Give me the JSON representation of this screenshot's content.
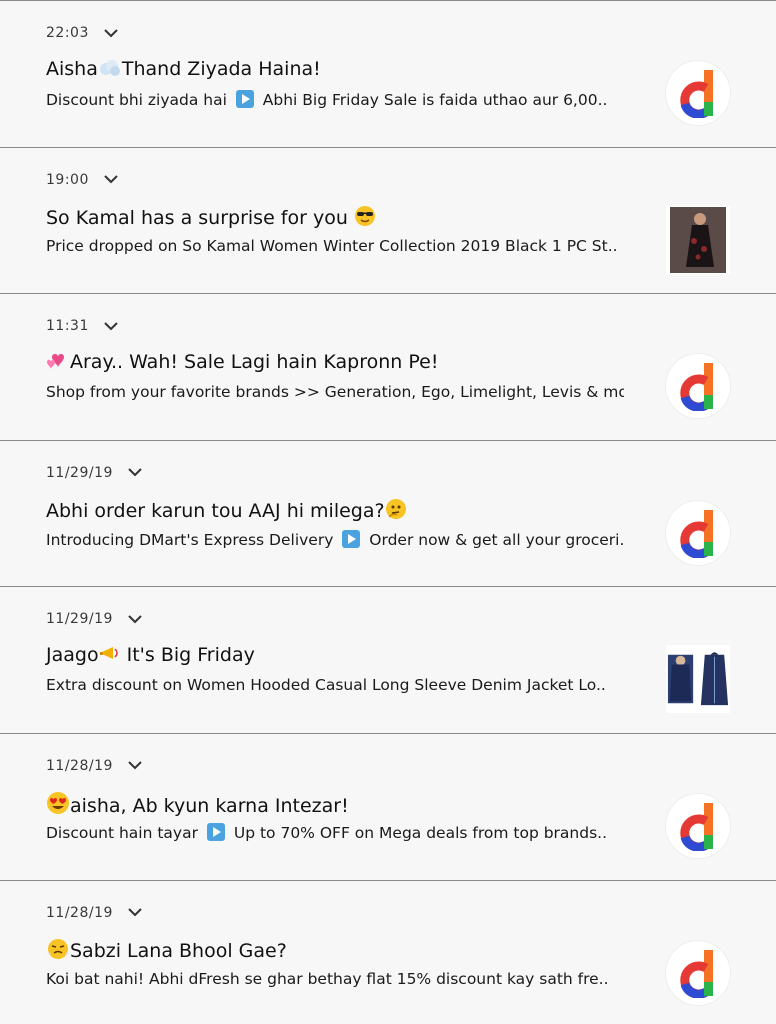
{
  "notifications": [
    {
      "time": "22:03",
      "title_emoji": "cloud-emoji",
      "title_prefix": "Aisha",
      "title_suffix": "Thand Ziyada Haina!",
      "body_prefix": "Discount bhi ziyada hai",
      "body_suffix": "Abhi Big Friday Sale is faida uthao aur 6,00..",
      "thumb": "daraz-logo"
    },
    {
      "time": "19:00",
      "title_prefix": "So Kamal has a surprise for you",
      "title_emoji": "sunglasses-emoji",
      "body_prefix": "Price dropped on So Kamal Women Winter Collection 2019 Black 1 PC St..",
      "thumb": "product-photo-dress"
    },
    {
      "time": "11:31",
      "title_emoji": "hearts-emoji",
      "title_prefix": "",
      "title_suffix": "Aray.. Wah! Sale Lagi hain Kapronn Pe!",
      "body_prefix": "Shop from your favorite brands >> Generation, Ego, Limelight, Levis & mo..",
      "thumb": "daraz-logo"
    },
    {
      "time": "11/29/19",
      "title_prefix": "Abhi order karun tou AAJ hi milega?",
      "title_emoji": "thinking-emoji",
      "body_prefix": "Introducing DMart's Express Delivery",
      "body_suffix": "Order now & get all your groceri..",
      "thumb": "daraz-logo"
    },
    {
      "time": "11/29/19",
      "title_prefix": "Jaago",
      "title_emoji": "horn-emoji",
      "title_suffix": " It's Big Friday",
      "body_prefix": "Extra discount on Women Hooded Casual Long Sleeve Denim Jacket Lo..",
      "thumb": "product-photo-jacket"
    },
    {
      "time": "11/28/19",
      "title_emoji": "heart-eyes-emoji",
      "title_prefix": "",
      "title_suffix": "aisha, Ab kyun karna Intezar!",
      "body_prefix": "Discount hain tayar",
      "body_suffix": "Up to 70% OFF on Mega deals from top brands..",
      "thumb": "daraz-logo"
    },
    {
      "time": "11/28/19",
      "title_emoji": "huffing-emoji",
      "title_prefix": "",
      "title_suffix": "Sabzi Lana Bhool Gae?",
      "body_prefix": "Koi bat nahi! Abhi dFresh se ghar bethay flat 15% discount kay sath fre..",
      "thumb": "daraz-logo"
    }
  ],
  "colors": {
    "background": "#f7f7f7",
    "divider": "#8a8a8a",
    "play_button": "#4aa3df",
    "logo_orange": "#f57224",
    "logo_red": "#e53935",
    "logo_blue": "#2f4bd1",
    "logo_green": "#2ab24b"
  }
}
